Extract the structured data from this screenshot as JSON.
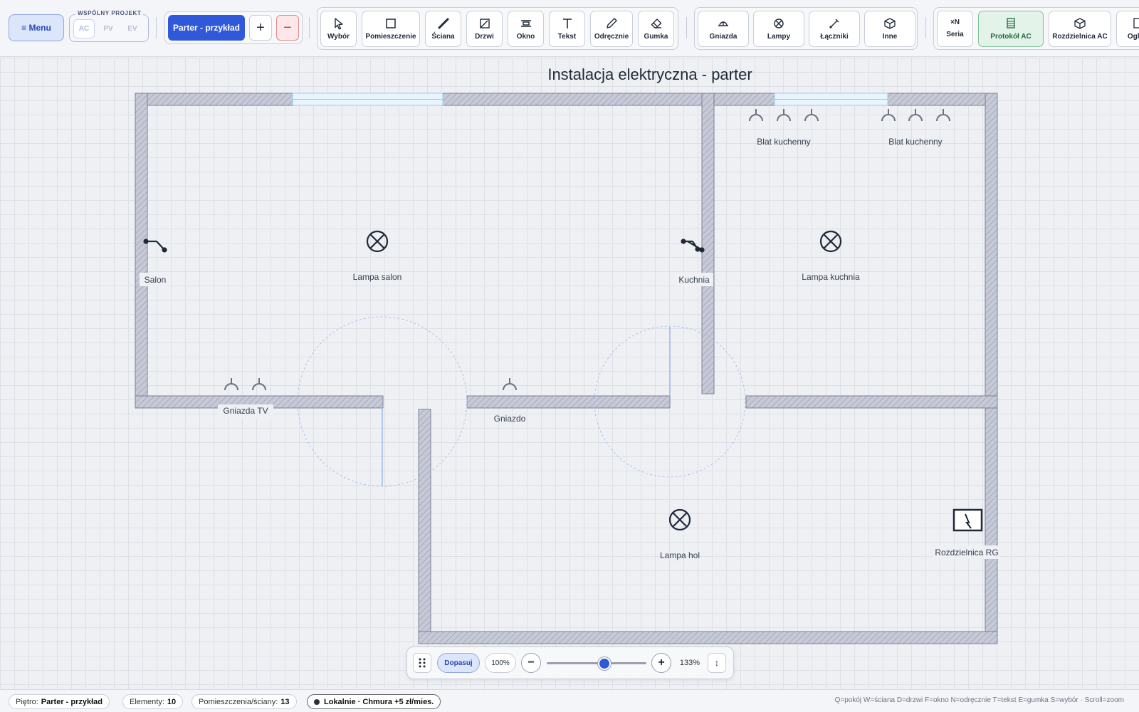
{
  "toolbar": {
    "menu_label": "≡ Menu",
    "project_group_label": "WSPÓLNY PROJEKT",
    "project_tabs": [
      "AC",
      "PV",
      "EV"
    ],
    "floor_label": "Parter - przykład",
    "floor_add": "+",
    "floor_remove": "−",
    "draw_tools": [
      {
        "label": "Wybór",
        "icon": "cursor-icon"
      },
      {
        "label": "Pomieszczenie",
        "icon": "room-icon"
      },
      {
        "label": "Ściana",
        "icon": "wall-icon"
      },
      {
        "label": "Drzwi",
        "icon": "door-icon"
      },
      {
        "label": "Okno",
        "icon": "window-icon"
      },
      {
        "label": "Tekst",
        "icon": "text-icon"
      },
      {
        "label": "Odręcznie",
        "icon": "pencil-icon"
      },
      {
        "label": "Gumka",
        "icon": "eraser-icon"
      }
    ],
    "elec_tools": [
      {
        "label": "Gniazda",
        "icon": "socket-icon"
      },
      {
        "label": "Lampy",
        "icon": "lamp-icon"
      },
      {
        "label": "Łączniki",
        "icon": "switch-icon"
      },
      {
        "label": "Inne",
        "icon": "box-icon"
      }
    ],
    "extra_tools": [
      {
        "label": "Seria",
        "icon_text": "×N"
      },
      {
        "label": "Protokół AC",
        "icon": "protocol-icon"
      },
      {
        "label": "Rozdzielnica AC",
        "icon": "box-icon"
      },
      {
        "label": "Oględ",
        "icon": "inspect-icon"
      }
    ]
  },
  "plan": {
    "title": "Instalacja elektryczna - parter",
    "labels": {
      "salon": "Salon",
      "lampa_salon": "Lampa salon",
      "kuchnia": "Kuchnia",
      "lampa_kuchnia": "Lampa kuchnia",
      "blat1": "Blat kuchenny",
      "blat2": "Blat kuchenny",
      "gniazda_tv": "Gniazda TV",
      "gniazdo": "Gniazdo",
      "lampa_hol": "Lampa hol",
      "rozdzielnica": "Rozdzielnica RG"
    }
  },
  "zoom": {
    "fit_label": "Dopasuj",
    "reset_label": "100%",
    "minus": "−",
    "plus": "+",
    "level_label": "133%",
    "level_fraction": 0.58,
    "expand": "↕"
  },
  "status": {
    "floor_prefix": "Piętro:",
    "floor_value": "Parter - przykład",
    "elements_prefix": "Elementy:",
    "elements_value": "10",
    "rooms_prefix": "Pomieszczenia/ściany:",
    "rooms_value": "13",
    "storage": "Lokalnie · Chmura +5 zł/mies.",
    "shortcuts": "Q=pokój W=ściana D=drzwi F=okno N=odręcznie T=tekst E=gumka S=wybór · Scroll=zoom"
  },
  "colors": {
    "accent": "#2f59d9",
    "wall_fill": "#c7cad6",
    "window": "#8fd0ee",
    "door_swing": "#9fb9f0",
    "protocol_green": "#e4f3ea"
  }
}
